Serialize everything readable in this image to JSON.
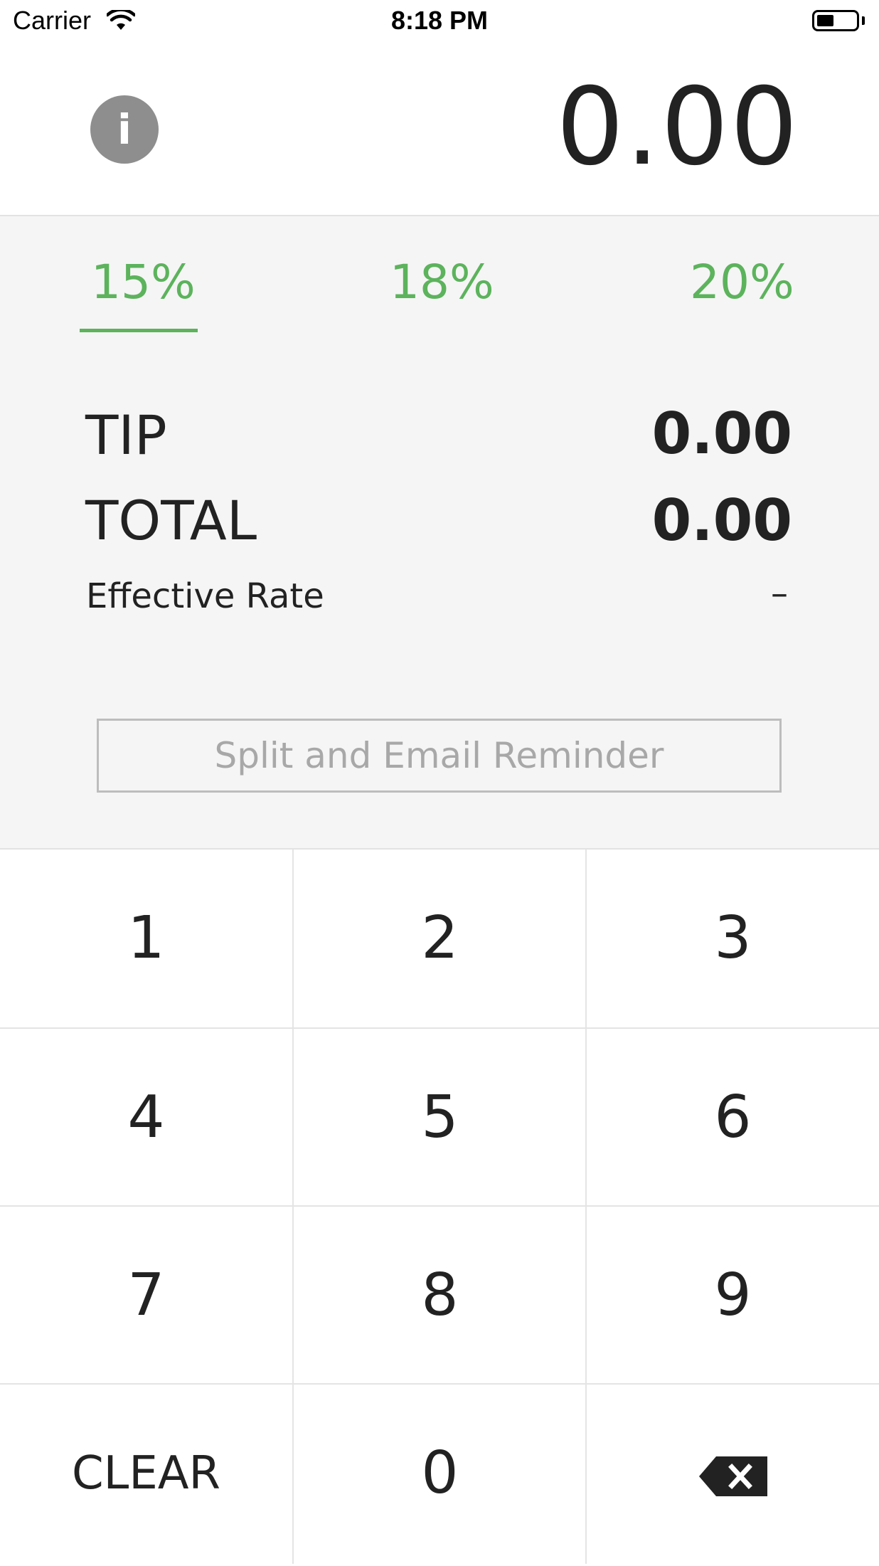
{
  "status_bar": {
    "carrier": "Carrier",
    "time": "8:18 PM",
    "battery_level": 0.45,
    "icons": [
      "wifi-icon",
      "battery-icon"
    ]
  },
  "header": {
    "info_label": "i",
    "bill_amount": "0.00"
  },
  "tip_options": [
    {
      "label": "15%",
      "selected": true
    },
    {
      "label": "18%",
      "selected": false
    },
    {
      "label": "20%",
      "selected": false
    }
  ],
  "summary": {
    "tip_label": "TIP",
    "tip_value": "0.00",
    "total_label": "TOTAL",
    "total_value": "0.00",
    "rate_label": "Effective Rate",
    "rate_value": "–"
  },
  "split_button": {
    "label": "Split and Email Reminder"
  },
  "keypad": {
    "keys": [
      "1",
      "2",
      "3",
      "4",
      "5",
      "6",
      "7",
      "8",
      "9",
      "CLEAR",
      "0"
    ],
    "backspace_icon": "backspace-icon"
  },
  "colors": {
    "accent": "#5cb35c",
    "panel_bg": "#f5f5f5",
    "info_button": "#8e8e8e"
  }
}
